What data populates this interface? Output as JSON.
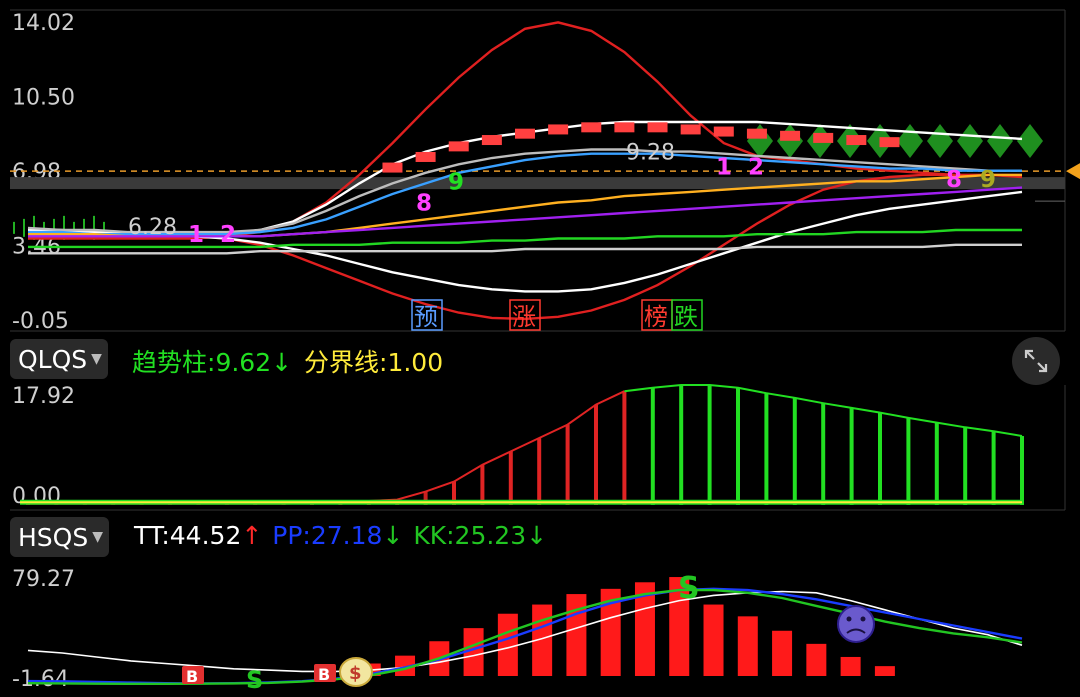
{
  "main_panel": {
    "y_ticks": [
      "14.02",
      "10.50",
      "6.98",
      "3.46",
      "-0.05"
    ],
    "markers": [
      {
        "text": "预",
        "color": "#5a9cff"
      },
      {
        "text": "涨",
        "color": "#ff3b30"
      },
      {
        "text": "榜",
        "color": "#ff3b30"
      },
      {
        "text": "跌",
        "color": "#22d622"
      }
    ],
    "value_labels": [
      "6.28",
      "9.28"
    ],
    "count_labels": [
      "1",
      "2",
      "8",
      "9",
      "1",
      "2",
      "8",
      "9"
    ]
  },
  "qlqs_panel": {
    "indicator": "QLQS",
    "trend_label": "趋势柱:",
    "trend_value": "9.62",
    "trend_arrow": "↓",
    "boundary_label": "分界线:",
    "boundary_value": "1.00",
    "y_ticks": [
      "17.92",
      "0.00"
    ]
  },
  "hsqs_panel": {
    "indicator": "HSQS",
    "tt_label": "TT:",
    "tt_value": "44.52",
    "tt_arrow": "↑",
    "pp_label": "PP:",
    "pp_value": "27.18",
    "pp_arrow": "↓",
    "kk_label": "KK:",
    "kk_value": "25.23",
    "kk_arrow": "↓",
    "y_ticks": [
      "79.27",
      "-1.64"
    ],
    "signals": [
      "B",
      "S",
      "B",
      "$",
      "S"
    ]
  },
  "colors": {
    "up": "#ff2a2a",
    "down": "#22e022",
    "boundary": "#ffeb3b",
    "pp": "#1a3cff",
    "kk": "#22c522"
  },
  "chart_data": [
    {
      "type": "line",
      "title": "",
      "ylim": [
        -0.05,
        14.02
      ],
      "x": [
        0,
        1,
        2,
        3,
        4,
        5,
        6,
        7,
        8,
        9,
        10,
        11,
        12,
        13,
        14,
        15,
        16,
        17,
        18,
        19,
        20,
        21,
        22,
        23,
        24,
        25,
        26,
        27,
        28,
        29,
        30
      ],
      "series": [
        {
          "name": "",
          "color": "#e02020",
          "values": [
            3.8,
            3.8,
            3.8,
            3.8,
            3.8,
            3.8,
            3.9,
            4.1,
            4.6,
            5.5,
            6.8,
            8.3,
            9.9,
            11.4,
            12.7,
            13.7,
            14.0,
            13.6,
            12.6,
            11.2,
            9.6,
            8.3,
            7.7,
            7.5,
            7.3,
            7.1,
            7.0,
            6.9,
            6.8,
            6.8,
            6.7
          ]
        },
        {
          "name": "",
          "color": "#e02020",
          "values": [
            3.9,
            3.9,
            3.9,
            3.9,
            3.9,
            3.9,
            3.8,
            3.5,
            3.0,
            2.4,
            1.8,
            1.2,
            0.7,
            0.3,
            0.05,
            0.0,
            0.1,
            0.4,
            0.9,
            1.6,
            2.5,
            3.5,
            4.5,
            5.4,
            6.1,
            6.5,
            6.7,
            6.8,
            6.8,
            6.8,
            6.8
          ]
        },
        {
          "name": "",
          "color": "#ffffff",
          "values": [
            4.2,
            4.2,
            4.1,
            4.0,
            4.0,
            4.0,
            4.0,
            4.2,
            4.6,
            5.4,
            6.4,
            7.3,
            7.9,
            8.3,
            8.6,
            8.8,
            9.0,
            9.2,
            9.3,
            9.3,
            9.3,
            9.3,
            9.3,
            9.2,
            9.1,
            9.0,
            8.9,
            8.8,
            8.7,
            8.6,
            8.5
          ]
        },
        {
          "name": "",
          "color": "#ffffff",
          "values": [
            3.9,
            3.9,
            3.9,
            3.9,
            3.9,
            3.9,
            3.8,
            3.6,
            3.3,
            3.0,
            2.6,
            2.2,
            1.9,
            1.6,
            1.4,
            1.3,
            1.3,
            1.4,
            1.7,
            2.1,
            2.6,
            3.1,
            3.6,
            4.1,
            4.5,
            4.9,
            5.2,
            5.4,
            5.6,
            5.8,
            6.0
          ]
        },
        {
          "name": "",
          "color": "#bdbdbd",
          "values": [
            4.3,
            4.2,
            4.2,
            4.1,
            4.1,
            4.1,
            4.1,
            4.2,
            4.5,
            5.1,
            5.8,
            6.4,
            6.9,
            7.3,
            7.6,
            7.8,
            7.9,
            8.0,
            8.0,
            7.9,
            7.9,
            7.8,
            7.7,
            7.6,
            7.5,
            7.4,
            7.3,
            7.2,
            7.1,
            7.0,
            7.0
          ]
        },
        {
          "name": "",
          "color": "#39a0ff",
          "values": [
            4.1,
            4.1,
            4.0,
            4.0,
            4.0,
            4.0,
            4.0,
            4.1,
            4.3,
            4.7,
            5.3,
            5.9,
            6.4,
            6.9,
            7.2,
            7.5,
            7.7,
            7.8,
            7.8,
            7.8,
            7.7,
            7.6,
            7.5,
            7.4,
            7.3,
            7.2,
            7.1,
            7.1,
            7.0,
            7.0,
            7.0
          ]
        },
        {
          "name": "",
          "color": "#ffb020",
          "values": [
            4.0,
            4.0,
            4.0,
            3.9,
            3.9,
            3.9,
            3.9,
            3.9,
            4.0,
            4.1,
            4.3,
            4.5,
            4.7,
            4.9,
            5.1,
            5.3,
            5.5,
            5.6,
            5.8,
            5.9,
            6.0,
            6.1,
            6.2,
            6.3,
            6.4,
            6.5,
            6.5,
            6.6,
            6.7,
            6.8,
            6.8
          ]
        },
        {
          "name": "",
          "color": "#a020f0",
          "values": [
            3.9,
            3.9,
            3.9,
            3.9,
            3.9,
            3.9,
            3.9,
            3.9,
            4.0,
            4.1,
            4.2,
            4.3,
            4.4,
            4.5,
            4.6,
            4.7,
            4.8,
            4.9,
            5.0,
            5.1,
            5.2,
            5.3,
            5.4,
            5.5,
            5.6,
            5.7,
            5.8,
            5.9,
            6.0,
            6.1,
            6.2
          ]
        },
        {
          "name": "",
          "color": "#22d622",
          "values": [
            3.4,
            3.4,
            3.4,
            3.4,
            3.4,
            3.4,
            3.4,
            3.4,
            3.5,
            3.5,
            3.5,
            3.6,
            3.6,
            3.6,
            3.7,
            3.7,
            3.8,
            3.8,
            3.8,
            3.9,
            3.9,
            3.9,
            4.0,
            4.0,
            4.0,
            4.1,
            4.1,
            4.1,
            4.2,
            4.2,
            4.2
          ]
        },
        {
          "name": "",
          "color": "#cfcfcf",
          "values": [
            3.1,
            3.1,
            3.1,
            3.1,
            3.1,
            3.1,
            3.1,
            3.2,
            3.2,
            3.2,
            3.2,
            3.2,
            3.2,
            3.2,
            3.2,
            3.3,
            3.3,
            3.3,
            3.3,
            3.3,
            3.3,
            3.3,
            3.4,
            3.4,
            3.4,
            3.4,
            3.4,
            3.4,
            3.5,
            3.5,
            3.5
          ]
        }
      ]
    },
    {
      "type": "bar",
      "title": "",
      "ylim": [
        0,
        17.92
      ],
      "categories": [
        "1",
        "2",
        "3",
        "4",
        "5",
        "6",
        "7",
        "8",
        "9",
        "10",
        "11",
        "12",
        "13",
        "14",
        "15",
        "16",
        "17",
        "18",
        "19",
        "20",
        "21",
        "22",
        "23",
        "24",
        "25",
        "26",
        "27",
        "28",
        "29",
        "30",
        "31"
      ],
      "series": [
        {
          "name": "趋势柱",
          "values": [
            0.2,
            0.2,
            0.2,
            0.2,
            0.2,
            0.2,
            0.2,
            0.2,
            0.2,
            0.2,
            0.3,
            0.4,
            0.6,
            0.8,
            2.0,
            3.5,
            6.0,
            8.0,
            10.0,
            12.0,
            15.0,
            17.0,
            17.5,
            17.92,
            17.92,
            17.5,
            16.7,
            16.0,
            15.2,
            14.5,
            13.8,
            13.0,
            12.3,
            11.6,
            11.0,
            10.3
          ]
        },
        {
          "name": "分界线",
          "values": [
            1.0
          ]
        }
      ]
    },
    {
      "type": "bar",
      "title": "",
      "ylim": [
        -1.64,
        79.27
      ],
      "categories": [
        "1",
        "2",
        "3",
        "4",
        "5",
        "6",
        "7",
        "8",
        "9",
        "10",
        "11",
        "12",
        "13",
        "14",
        "15",
        "16",
        "17",
        "18",
        "19",
        "20",
        "21",
        "22",
        "23",
        "24",
        "25",
        "26",
        "27",
        "28",
        "29",
        "30"
      ],
      "series": [
        {
          "name": "TT",
          "values": [
            24,
            22,
            19,
            16,
            14,
            12,
            10,
            9,
            8,
            8,
            9,
            11,
            15,
            20,
            26,
            33,
            41,
            49,
            56,
            62,
            66,
            68,
            69,
            68,
            62,
            55,
            48,
            41,
            36,
            28
          ]
        },
        {
          "name": "PP",
          "values": [
            0.6,
            0.4,
            0.0,
            -0.6,
            -1.0,
            -1.2,
            -1.0,
            -0.4,
            0.5,
            2.5,
            6,
            11,
            17,
            25,
            33,
            42,
            52,
            60,
            66,
            70,
            71,
            70,
            67,
            63,
            58,
            53,
            48,
            43,
            38,
            33
          ]
        },
        {
          "name": "KK",
          "values": [
            -1.0,
            -1.2,
            -1.4,
            -1.5,
            -1.5,
            -1.4,
            -1.2,
            -0.8,
            0.2,
            2.0,
            5,
            10,
            18,
            28,
            38,
            47,
            55,
            62,
            67,
            70,
            70,
            68,
            64,
            58,
            52,
            46,
            41,
            37,
            34,
            30
          ]
        },
        {
          "name": "",
          "values": [
            0,
            0,
            0,
            0,
            0,
            0,
            0,
            0,
            0,
            0,
            14,
            20,
            31,
            41,
            52,
            59,
            67,
            71,
            76,
            80,
            59,
            50,
            39,
            29,
            19,
            12,
            0,
            0,
            0,
            0
          ]
        }
      ]
    }
  ]
}
